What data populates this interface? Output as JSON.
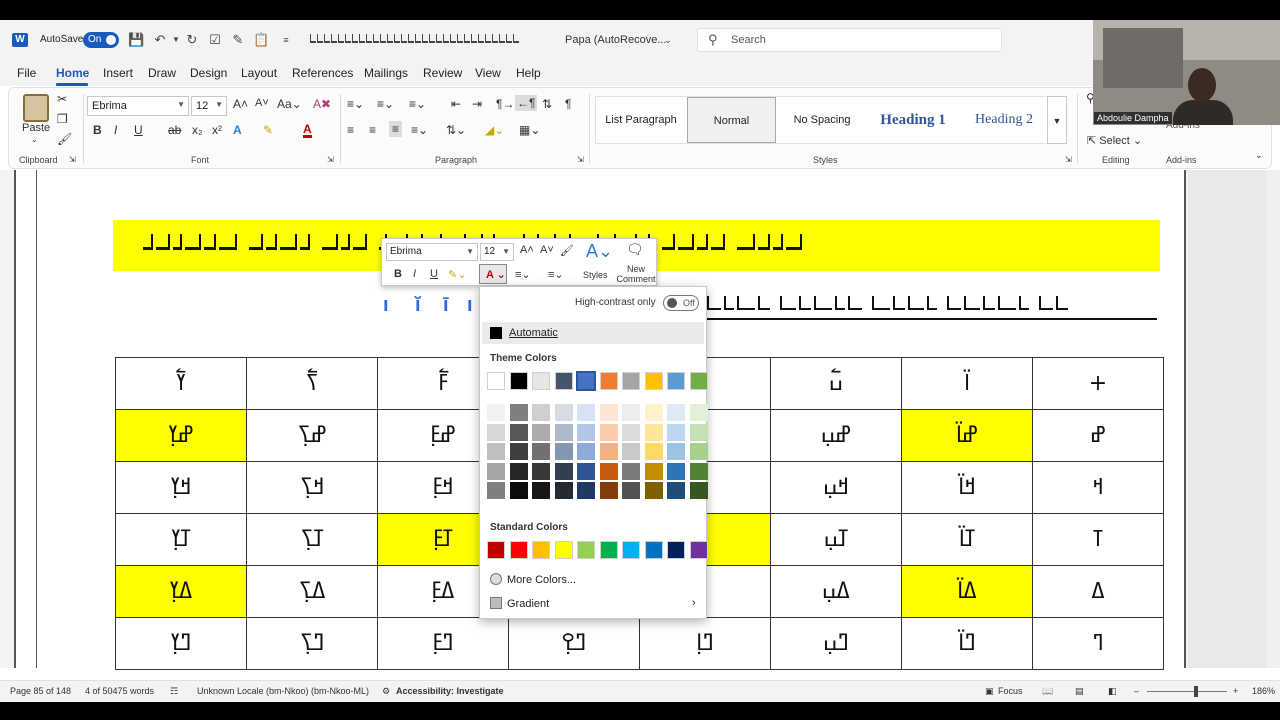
{
  "window": {
    "autosave_label": "AutoSave",
    "autosave_state": "On",
    "doc_name": "Papa (AutoRecove...",
    "search_placeholder": "Search"
  },
  "tabs": [
    "File",
    "Home",
    "Insert",
    "Draw",
    "Design",
    "Layout",
    "References",
    "Mailings",
    "Review",
    "View",
    "Help"
  ],
  "ribbon": {
    "clipboard": {
      "paste": "Paste",
      "label": "Clipboard"
    },
    "font": {
      "name": "Ebrima",
      "size": "12",
      "label": "Font"
    },
    "paragraph": {
      "label": "Paragraph"
    },
    "styles": {
      "items": [
        "List Paragraph",
        "Normal",
        "No Spacing",
        "Heading 1",
        "Heading 2"
      ],
      "selected": "Normal",
      "label": "Styles"
    },
    "editing": {
      "select": "Select",
      "label": "Editing"
    },
    "addins": {
      "label": "Add-ins",
      "button": "Add-ins"
    }
  },
  "video": {
    "participant": "Abdoulie Dampha"
  },
  "mini_toolbar": {
    "font": "Ebrima",
    "size": "12",
    "styles": "Styles",
    "new_comment": "New Comment"
  },
  "color_panel": {
    "high_contrast": "High-contrast only",
    "toggle": "Off",
    "automatic": "Automatic",
    "theme_colors_label": "Theme Colors",
    "theme_colors": [
      "#ffffff",
      "#000000",
      "#e7e6e6",
      "#44546a",
      "#4472c4",
      "#ed7d31",
      "#a5a5a5",
      "#ffc000",
      "#5b9bd5",
      "#70ad47"
    ],
    "theme_shades": [
      [
        "#f2f2f2",
        "#7f7f7f",
        "#d0cece",
        "#d6dce4",
        "#d9e2f3",
        "#fbe5d5",
        "#ededed",
        "#fff2cc",
        "#deebf6",
        "#e2efd9"
      ],
      [
        "#d8d8d8",
        "#595959",
        "#aeaaaa",
        "#adb9ca",
        "#b4c6e7",
        "#f7cbac",
        "#dbdbdb",
        "#fee599",
        "#bdd7ee",
        "#c5e0b3"
      ],
      [
        "#bfbfbf",
        "#3f3f3f",
        "#757070",
        "#8496b0",
        "#8eaadb",
        "#f4b183",
        "#c9c9c9",
        "#ffd965",
        "#9cc3e5",
        "#a8d08d"
      ],
      [
        "#a5a5a5",
        "#262626",
        "#3a3838",
        "#323f4f",
        "#2f5496",
        "#c55a11",
        "#7b7b7b",
        "#bf8f00",
        "#2e75b5",
        "#538135"
      ],
      [
        "#7f7f7f",
        "#0c0c0c",
        "#171616",
        "#222a35",
        "#1f3864",
        "#833c0b",
        "#525252",
        "#7f6000",
        "#1e4e79",
        "#375623"
      ]
    ],
    "standard_colors_label": "Standard Colors",
    "standard_colors": [
      "#c00000",
      "#ff0000",
      "#ffc000",
      "#ffff00",
      "#92d050",
      "#00b050",
      "#00b0f0",
      "#0070c0",
      "#002060",
      "#7030a0"
    ],
    "more_colors": "More Colors...",
    "gradient": "Gradient"
  },
  "table": {
    "rows": [
      [
        "ߌ߱",
        "ߖ߱",
        "ߓ߱",
        "",
        "",
        "ߎ߱",
        "ߊ߳",
        "+"
      ],
      [
        "ߝߌ߲",
        "ߝߖ߲",
        "ߝߓ߲",
        "",
        "",
        "ߝߎ߲",
        "ߝߊ߳",
        "ߝ"
      ],
      [
        "ߞߌ߲",
        "ߞߖ߲",
        "ߞߓ߲",
        "",
        "",
        "ߞߎ߲",
        "ߞߊ߳",
        "ߞ"
      ],
      [
        "ߠߌ߲",
        "ߠߖ߲",
        "ߠߓ߲",
        "",
        "",
        "ߠߎ߲",
        "ߠߊ߳",
        "ߠ"
      ],
      [
        "ߡߌ߲",
        "ߡߖ߲",
        "ߡߓ߲",
        "",
        "",
        "ߡߎ߲",
        "ߡߊ߳",
        "ߡ"
      ],
      [
        "ߣߌ߲",
        "ߣߖ߲",
        "ߣߓ߲",
        "ߣߐ߲",
        "ߣߊ߲",
        "ߣߎ߲",
        "ߣߊ߳",
        "ߣ"
      ]
    ],
    "yellow": [
      [
        1,
        0
      ],
      [
        1,
        6
      ],
      [
        3,
        2
      ],
      [
        3,
        4
      ],
      [
        4,
        0
      ],
      [
        4,
        6
      ]
    ]
  },
  "statusbar": {
    "page": "Page 85 of 148",
    "words": "4 of 50475 words",
    "locale": "Unknown Locale (bm-Nkoo) (bm-Nkoo-ML)",
    "accessibility": "Accessibility: Investigate",
    "focus": "Focus",
    "zoom": "186%"
  }
}
